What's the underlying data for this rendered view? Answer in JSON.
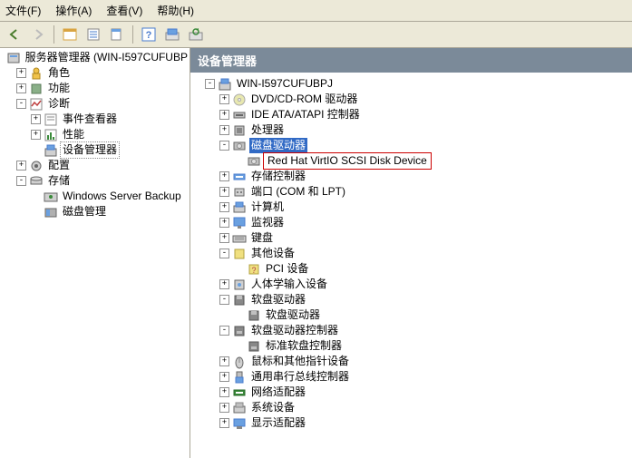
{
  "menubar": [
    {
      "label": "文件(F)"
    },
    {
      "label": "操作(A)"
    },
    {
      "label": "查看(V)"
    },
    {
      "label": "帮助(H)"
    }
  ],
  "left_pane": {
    "root": "服务器管理器 (WIN-I597CUFUBP",
    "items": [
      {
        "depth": 1,
        "exp": "+",
        "icon": "role",
        "label": "角色"
      },
      {
        "depth": 1,
        "exp": "+",
        "icon": "feature",
        "label": "功能"
      },
      {
        "depth": 1,
        "exp": "-",
        "icon": "diag",
        "label": "诊断"
      },
      {
        "depth": 2,
        "exp": "+",
        "icon": "event",
        "label": "事件查看器"
      },
      {
        "depth": 2,
        "exp": "+",
        "icon": "perf",
        "label": "性能"
      },
      {
        "depth": 2,
        "exp": "",
        "icon": "devmgr",
        "label": "设备管理器",
        "selected_box": true
      },
      {
        "depth": 1,
        "exp": "+",
        "icon": "config",
        "label": "配置"
      },
      {
        "depth": 1,
        "exp": "-",
        "icon": "storage",
        "label": "存储"
      },
      {
        "depth": 2,
        "exp": "",
        "icon": "wsb",
        "label": "Windows Server Backup"
      },
      {
        "depth": 2,
        "exp": "",
        "icon": "diskmgr",
        "label": "磁盘管理"
      }
    ]
  },
  "right_pane": {
    "header": "设备管理器",
    "root": "WIN-I597CUFUBPJ",
    "items": [
      {
        "depth": 1,
        "exp": "+",
        "icon": "dvd",
        "label": "DVD/CD-ROM 驱动器"
      },
      {
        "depth": 1,
        "exp": "+",
        "icon": "ide",
        "label": "IDE ATA/ATAPI 控制器"
      },
      {
        "depth": 1,
        "exp": "+",
        "icon": "cpu",
        "label": "处理器"
      },
      {
        "depth": 1,
        "exp": "-",
        "icon": "disk",
        "label": "磁盘驱动器",
        "selected": true
      },
      {
        "depth": 2,
        "exp": "",
        "icon": "disk",
        "label": "Red Hat VirtIO SCSI Disk Device",
        "highlighted": true
      },
      {
        "depth": 1,
        "exp": "+",
        "icon": "storage-ctrl",
        "label": "存储控制器"
      },
      {
        "depth": 1,
        "exp": "+",
        "icon": "port",
        "label": "端口 (COM 和 LPT)"
      },
      {
        "depth": 1,
        "exp": "+",
        "icon": "computer",
        "label": "计算机"
      },
      {
        "depth": 1,
        "exp": "+",
        "icon": "monitor",
        "label": "监视器"
      },
      {
        "depth": 1,
        "exp": "+",
        "icon": "keyboard",
        "label": "键盘"
      },
      {
        "depth": 1,
        "exp": "-",
        "icon": "other",
        "label": "其他设备"
      },
      {
        "depth": 2,
        "exp": "",
        "icon": "unknown",
        "label": "PCI 设备"
      },
      {
        "depth": 1,
        "exp": "+",
        "icon": "hid",
        "label": "人体学输入设备"
      },
      {
        "depth": 1,
        "exp": "-",
        "icon": "floppy",
        "label": "软盘驱动器"
      },
      {
        "depth": 2,
        "exp": "",
        "icon": "floppy",
        "label": "软盘驱动器"
      },
      {
        "depth": 1,
        "exp": "-",
        "icon": "floppy-ctrl",
        "label": "软盘驱动器控制器"
      },
      {
        "depth": 2,
        "exp": "",
        "icon": "floppy-ctrl",
        "label": "标准软盘控制器"
      },
      {
        "depth": 1,
        "exp": "+",
        "icon": "mouse",
        "label": "鼠标和其他指针设备"
      },
      {
        "depth": 1,
        "exp": "+",
        "icon": "usb",
        "label": "通用串行总线控制器"
      },
      {
        "depth": 1,
        "exp": "+",
        "icon": "network",
        "label": "网络适配器"
      },
      {
        "depth": 1,
        "exp": "+",
        "icon": "system",
        "label": "系统设备"
      },
      {
        "depth": 1,
        "exp": "+",
        "icon": "display",
        "label": "显示适配器"
      }
    ]
  }
}
